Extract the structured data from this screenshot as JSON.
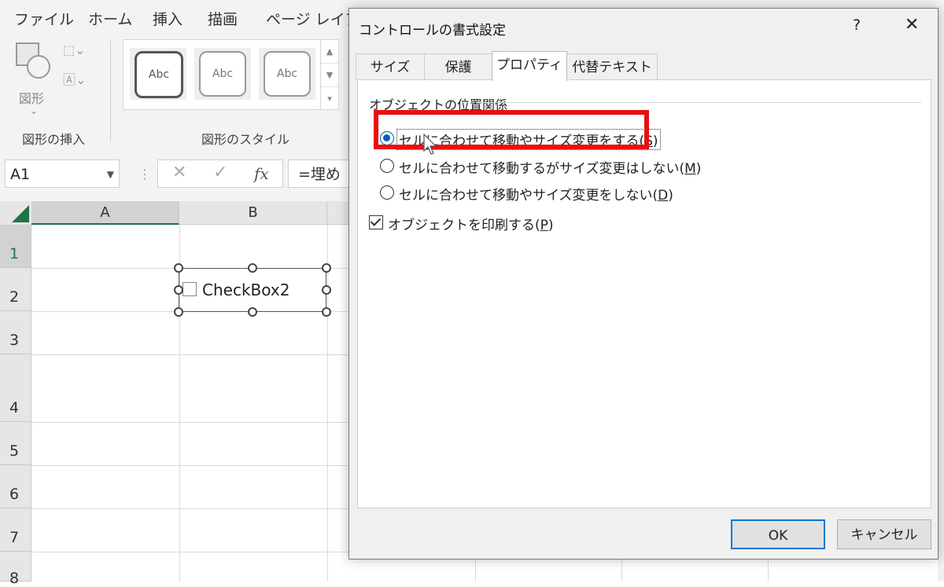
{
  "ribbon": {
    "tabs": [
      "ファイル",
      "ホーム",
      "挿入",
      "描画",
      "ページ レイアウ"
    ],
    "groups": {
      "insert_shapes": {
        "label": "図形の挿入",
        "shape_button": "図形"
      },
      "shape_styles": {
        "label": "図形のスタイル",
        "swatches": [
          "Abc",
          "Abc",
          "Abc"
        ]
      }
    }
  },
  "formula_bar": {
    "name_box": "A1",
    "fx_label": "fx",
    "formula": "=埋め"
  },
  "sheet": {
    "columns": [
      "A",
      "B"
    ],
    "rows": [
      "1",
      "2",
      "3",
      "4",
      "5",
      "6",
      "7",
      "8"
    ],
    "checkbox_label": "CheckBox2"
  },
  "dialog": {
    "title": "コントロールの書式設定",
    "help": "?",
    "close": "✕",
    "tabs": [
      "サイズ",
      "保護",
      "プロパティ",
      "代替テキスト"
    ],
    "active_tab": "プロパティ",
    "section_title": "オブジェクトの位置関係",
    "options": [
      {
        "text": "セルに合わせて移動やサイズ変更をする(",
        "key": "S",
        "selected": true
      },
      {
        "text": "セルに合わせて移動するがサイズ変更はしない(",
        "key": "M",
        "selected": false
      },
      {
        "text": "セルに合わせて移動やサイズ変更をしない(",
        "key": "D",
        "selected": false
      }
    ],
    "print_checkbox": {
      "text": "オブジェクトを印刷する(",
      "key": "P",
      "checked": true
    },
    "ok": "OK",
    "cancel": "キャンセル"
  },
  "colors": {
    "excel_green": "#217346",
    "highlight_red": "#e81010",
    "radio_blue": "#005fb8"
  }
}
